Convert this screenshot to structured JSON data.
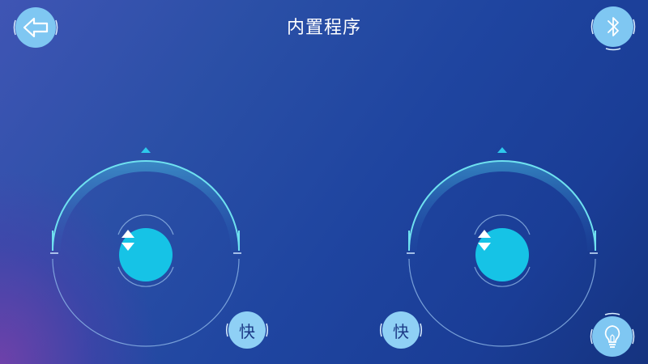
{
  "header": {
    "title": "内置程序",
    "back_icon": "arrow-left-icon",
    "bluetooth_icon": "bluetooth-icon"
  },
  "left_joystick": {
    "speed_label": "快",
    "knob_icon": "up-down-arrows-icon"
  },
  "right_joystick": {
    "speed_label": "快",
    "knob_icon": "up-down-arrows-icon"
  },
  "light_button": {
    "icon": "lightbulb-icon"
  },
  "colors": {
    "accent_cyan": "#16c3e6",
    "button_light_blue": "#7fc7f2",
    "arc_line": "#6fe1f0",
    "background_dark": "#15337f"
  }
}
